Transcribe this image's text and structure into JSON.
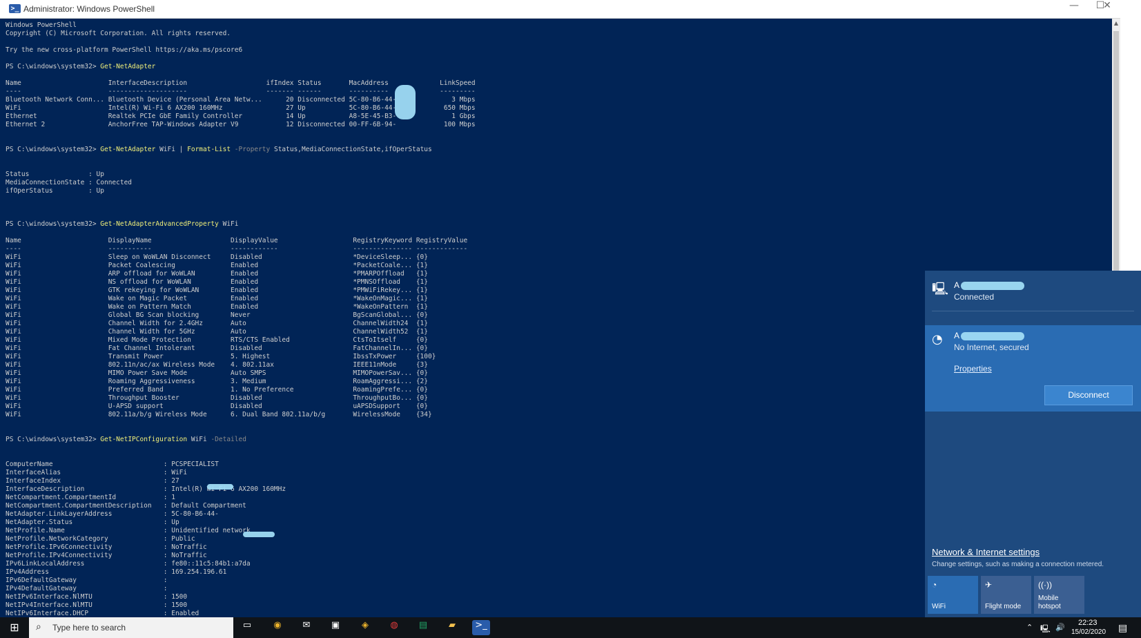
{
  "window": {
    "title": "Administrator: Windows PowerShell",
    "icon": "powershell-icon",
    "controls": {
      "minimize": "—",
      "maximize": "☐",
      "close": "✕"
    }
  },
  "console": {
    "banner": [
      "Windows PowerShell",
      "Copyright (C) Microsoft Corporation. All rights reserved.",
      "",
      "Try the new cross-platform PowerShell https://aka.ms/pscore6",
      ""
    ],
    "prompt": "PS C:\\windows\\system32> ",
    "cmd1": "Get-NetAdapter",
    "table1": [
      "",
      "Name                      InterfaceDescription                    ifIndex Status       MacAddress             LinkSpeed",
      "----                      --------------------                    ------- ------       ----------             ---------",
      "Bluetooth Network Conn... Bluetooth Device (Personal Area Netw...      20 Disconnected 5C-80-B6-44-              3 Mbps",
      "WiFi                      Intel(R) Wi-Fi 6 AX200 160MHz                27 Up           5C-80-B6-44-            650 Mbps",
      "Ethernet                  Realtek PCIe GbE Family Controller           14 Up           A8-5E-45-B3-              1 Gbps",
      "Ethernet 2                AnchorFree TAP-Windows Adapter V9            12 Disconnected 00-FF-6B-94-            100 Mbps",
      "",
      ""
    ],
    "cmd2": {
      "name": "Get-NetAdapter",
      "arg": " WiFi | ",
      "fmt": "Format-List",
      "param": " -Property",
      "rest": " Status,MediaConnectionState,ifOperStatus"
    },
    "list1": [
      "",
      "",
      "Status               : Up",
      "MediaConnectionState : Connected",
      "ifOperStatus         : Up",
      "",
      "",
      ""
    ],
    "cmd3": {
      "name": "Get-NetAdapterAdvancedProperty",
      "arg": " WiFi"
    },
    "table2": [
      "",
      "Name                      DisplayName                    DisplayValue                   RegistryKeyword RegistryValue",
      "----                      -----------                    ------------                   --------------- -------------",
      "WiFi                      Sleep on WoWLAN Disconnect     Disabled                       *DeviceSleep... {0}",
      "WiFi                      Packet Coalescing              Enabled                        *PacketCoale... {1}",
      "WiFi                      ARP offload for WoWLAN         Enabled                        *PMARPOffload   {1}",
      "WiFi                      NS offload for WoWLAN          Enabled                        *PMNSOffload    {1}",
      "WiFi                      GTK rekeying for WoWLAN        Enabled                        *PMWiFiRekey... {1}",
      "WiFi                      Wake on Magic Packet           Enabled                        *WakeOnMagic... {1}",
      "WiFi                      Wake on Pattern Match          Enabled                        *WakeOnPattern  {1}",
      "WiFi                      Global BG Scan blocking        Never                          BgScanGlobal... {0}",
      "WiFi                      Channel Width for 2.4GHz       Auto                           ChannelWidth24  {1}",
      "WiFi                      Channel Width for 5GHz         Auto                           ChannelWidth52  {1}",
      "WiFi                      Mixed Mode Protection          RTS/CTS Enabled                CtsToItself     {0}",
      "WiFi                      Fat Channel Intolerant         Disabled                       FatChannelIn... {0}",
      "WiFi                      Transmit Power                 5. Highest                     IbssTxPower     {100}",
      "WiFi                      802.11n/ac/ax Wireless Mode    4. 802.11ax                    IEEE11nMode     {3}",
      "WiFi                      MIMO Power Save Mode           Auto SMPS                      MIMOPowerSav... {0}",
      "WiFi                      Roaming Aggressiveness         3. Medium                      RoamAggressi... {2}",
      "WiFi                      Preferred Band                 1. No Preference               RoamingPrefe... {0}",
      "WiFi                      Throughput Booster             Disabled                       ThroughputBo... {0}",
      "WiFi                      U-APSD support                 Disabled                       uAPSDSupport    {0}",
      "WiFi                      802.11a/b/g Wireless Mode      6. Dual Band 802.11a/b/g       WirelessMode    {34}",
      "",
      ""
    ],
    "cmd4": {
      "name": "Get-NetIPConfiguration",
      "arg": " WiFi",
      "param": " -Detailed"
    },
    "list2": [
      "",
      "",
      "ComputerName                            : PCSPECIALIST",
      "InterfaceAlias                          : WiFi",
      "InterfaceIndex                          : 27",
      "InterfaceDescription                    : Intel(R) Wi-Fi 6 AX200 160MHz",
      "NetCompartment.CompartmentId            : 1",
      "NetCompartment.CompartmentDescription   : Default Compartment",
      "NetAdapter.LinkLayerAddress             : 5C-80-B6-44-",
      "NetAdapter.Status                       : Up",
      "NetProfile.Name                         : Unidentified network",
      "NetProfile.NetworkCategory              : Public",
      "NetProfile.IPv6Connectivity             : NoTraffic",
      "NetProfile.IPv4Connectivity             : NoTraffic",
      "IPv6LinkLocalAddress                    : fe80::11c5:84b1:a7da",
      "IPv4Address                             : 169.254.196.61",
      "IPv6DefaultGateway                      :",
      "IPv4DefaultGateway                      :",
      "NetIPv6Interface.NlMTU                  : 1500",
      "NetIPv4Interface.NlMTU                  : 1500",
      "NetIPv6Interface.DHCP                   : Enabled"
    ]
  },
  "flyout": {
    "ethernet": {
      "icon": "monitor-network-icon",
      "name": "A",
      "status": "Connected"
    },
    "wifi": {
      "icon": "wifi-icon",
      "name": "A",
      "status": "No Internet, secured",
      "properties": "Properties",
      "disconnect": "Disconnect"
    },
    "settings_link": "Network & Internet settings",
    "settings_sub": "Change settings, such as making a connection metered.",
    "tiles": [
      {
        "icon": "wifi-icon",
        "label": "WiFi"
      },
      {
        "icon": "airplane-icon",
        "label": "Flight mode"
      },
      {
        "icon": "hotspot-icon",
        "label": "Mobile hotspot"
      }
    ]
  },
  "taskbar": {
    "search_placeholder": "Type here to search",
    "time": "22:23",
    "date": "15/02/2020"
  },
  "colors": {
    "console_bg": "#012456",
    "command": "#f2f07a",
    "flyout_bg": "#1e4a7f",
    "wifi_card": "#2a6cb3"
  }
}
